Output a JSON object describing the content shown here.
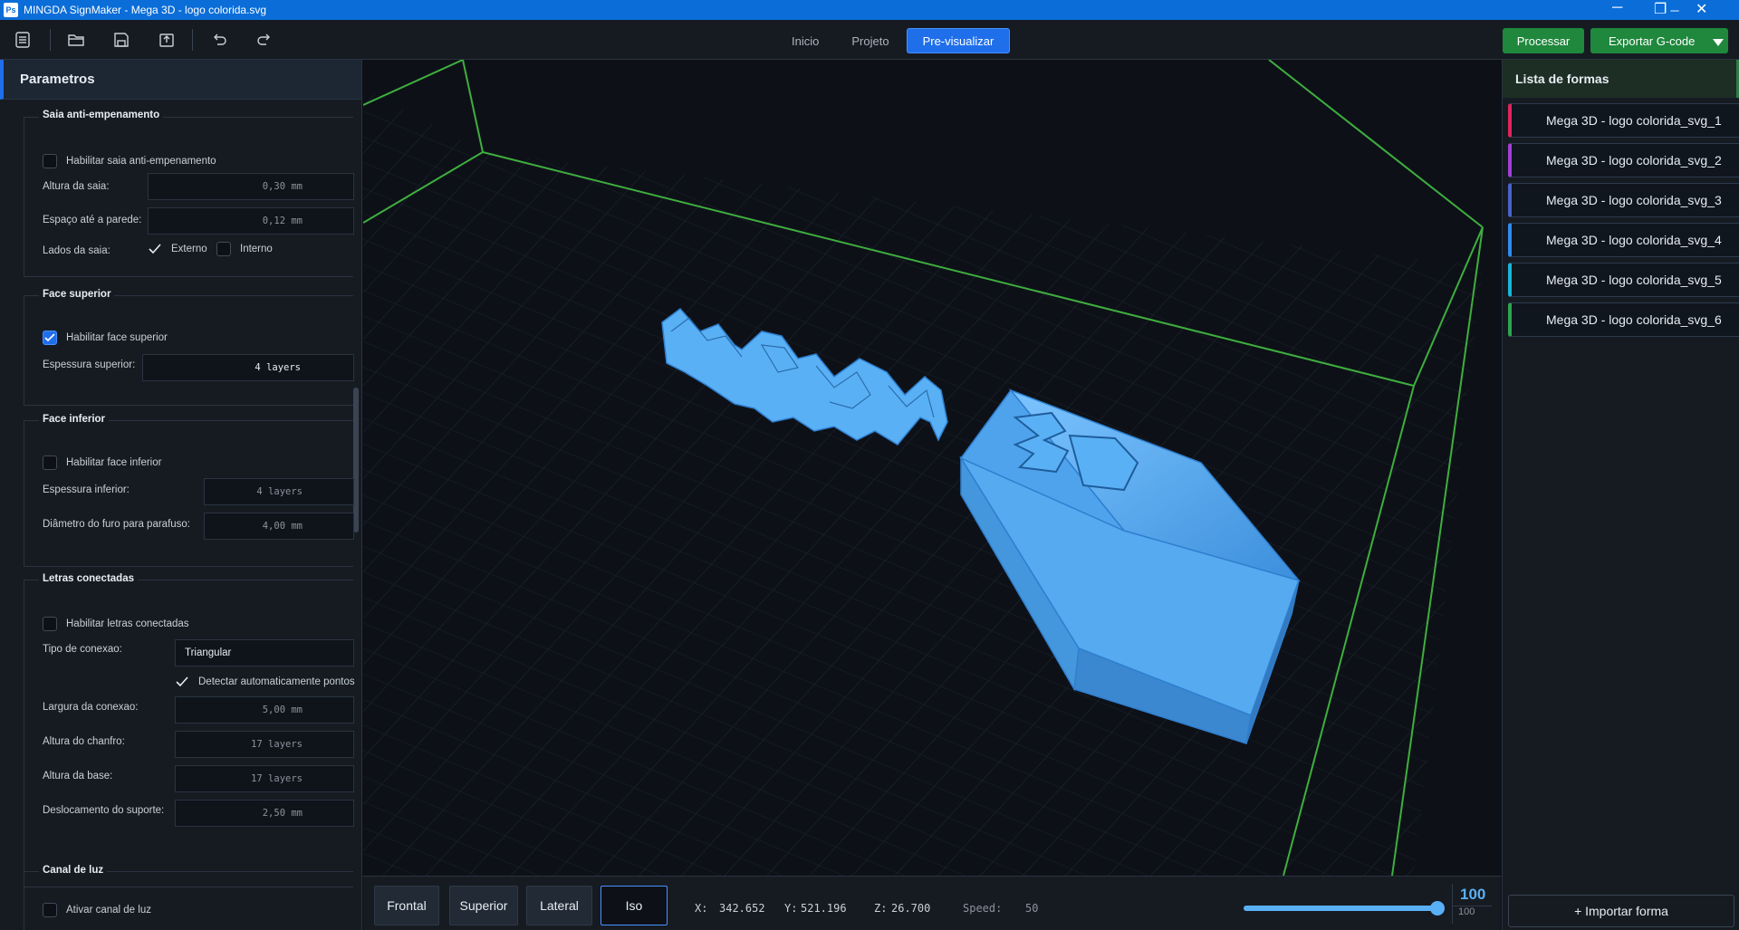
{
  "window": {
    "title": "MINGDA SignMaker - Mega 3D - logo colorida.svg",
    "app_icon": "Ps",
    "minimize": "─",
    "restore": "❐",
    "close": "✕"
  },
  "toolbar": {
    "icons": [
      "menu-icon",
      "folder-open-icon",
      "save-icon",
      "export-icon",
      "undo-icon",
      "redo-icon"
    ],
    "tabs": [
      {
        "label": "Inicio"
      },
      {
        "label": "Projeto"
      },
      {
        "label": "Pre-visualizar"
      }
    ],
    "process_label": "Processar",
    "export_label": "Exportar G-code"
  },
  "left_panel": {
    "title": "Parametros",
    "skirt": {
      "title": "Saia anti-empenamento",
      "enable_label": "Habilitar saia anti-empenamento",
      "height_label": "Altura da saia:",
      "height_value": "0,30 mm",
      "gap_label": "Espaço até a parede:",
      "gap_value": "0,12 mm",
      "sides_label": "Lados da saia:",
      "external_label": "Externo",
      "internal_label": "Interno"
    },
    "top_face": {
      "title": "Face superior",
      "enable_label": "Habilitar face superior",
      "thickness_label": "Espessura superior:",
      "thickness_value": "4 layers"
    },
    "bottom_face": {
      "title": "Face inferior",
      "enable_label": "Habilitar face inferior",
      "thickness_label": "Espessura inferior:",
      "thickness_value": "4 layers",
      "hole_label": "Diâmetro do furo para parafuso:",
      "hole_value": "4,00 mm"
    },
    "connected": {
      "title": "Letras conectadas",
      "enable_label": "Habilitar letras conectadas",
      "type_label": "Tipo de conexao:",
      "type_value": "Triangular",
      "auto_label": "Detectar automaticamente pontos",
      "width_label": "Largura da conexao:",
      "width_value": "5,00 mm",
      "chamfer_label": "Altura do chanfro:",
      "chamfer_value": "17 layers",
      "base_label": "Altura da base:",
      "base_value": "17 layers",
      "offset_label": "Deslocamento do suporte:",
      "offset_value": "2,50 mm"
    },
    "light": {
      "title": "Canal de luz",
      "enable_label": "Ativar canal de luz"
    }
  },
  "viewport": {
    "views": [
      {
        "label": "Frontal"
      },
      {
        "label": "Superior"
      },
      {
        "label": "Lateral"
      },
      {
        "label": "Iso"
      }
    ],
    "x_label": "X:",
    "x_value": "342.652",
    "y_label": "Y:",
    "y_value": "521.196",
    "z_label": "Z:",
    "z_value": "26.700",
    "speed_label": "Speed:",
    "speed_value": "50",
    "layer_value": "100",
    "layer_max": "100",
    "slider_fraction": 1.0,
    "model_color": "#5ab0f5"
  },
  "right_panel": {
    "title": "Lista de formas",
    "shapes": [
      {
        "label": "Mega 3D - logo colorida_svg_1",
        "color": "#e0245e"
      },
      {
        "label": "Mega 3D - logo colorida_svg_2",
        "color": "#a23fd6"
      },
      {
        "label": "Mega 3D - logo colorida_svg_3",
        "color": "#4a62c8"
      },
      {
        "label": "Mega 3D - logo colorida_svg_4",
        "color": "#2f8cf0"
      },
      {
        "label": "Mega 3D - logo colorida_svg_5",
        "color": "#18b5d9"
      },
      {
        "label": "Mega 3D - logo colorida_svg_6",
        "color": "#2ea44f"
      }
    ],
    "import_label": "+ Importar forma"
  }
}
